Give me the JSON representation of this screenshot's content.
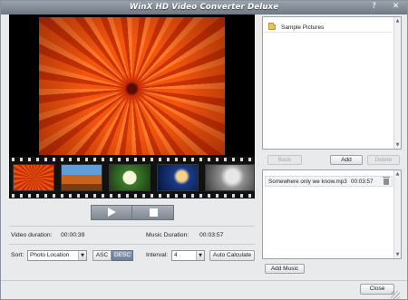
{
  "window": {
    "title": "WinX HD Video Converter Deluxe",
    "help_glyph": "?",
    "close_glyph": "✕"
  },
  "colors": {
    "titlebar": "#7c858f",
    "window_bg": "#e9eaec",
    "panel_bg": "#ffffff",
    "transport": "#8f979f"
  },
  "preview": {
    "thumbnails": [
      "chrysanthemum",
      "desert",
      "white-flower",
      "jellyfish",
      "koala"
    ],
    "play_icon": "play-icon",
    "stop_icon": "stop-icon"
  },
  "info": {
    "video_duration_label": "Video duration:",
    "video_duration_value": "00:00:39",
    "music_duration_label": "Music Duration:",
    "music_duration_value": "00:03:57"
  },
  "controls": {
    "sort_label": "Sort:",
    "sort_value": "Photo Location",
    "asc_label": "ASC",
    "desc_label": "DESC",
    "interval_label": "Interval:",
    "interval_value": "4",
    "auto_calc_label": "Auto Calculate"
  },
  "folders": {
    "items": [
      {
        "label": "Sample Pictures"
      }
    ],
    "back_label": "Back",
    "add_label": "Add",
    "delete_label": "Delete"
  },
  "music": {
    "items": [
      {
        "name": "Somewhere only we know.mp3",
        "duration": "00:03:57"
      }
    ],
    "add_music_label": "Add Music"
  },
  "footer": {
    "close_label": "Close"
  }
}
